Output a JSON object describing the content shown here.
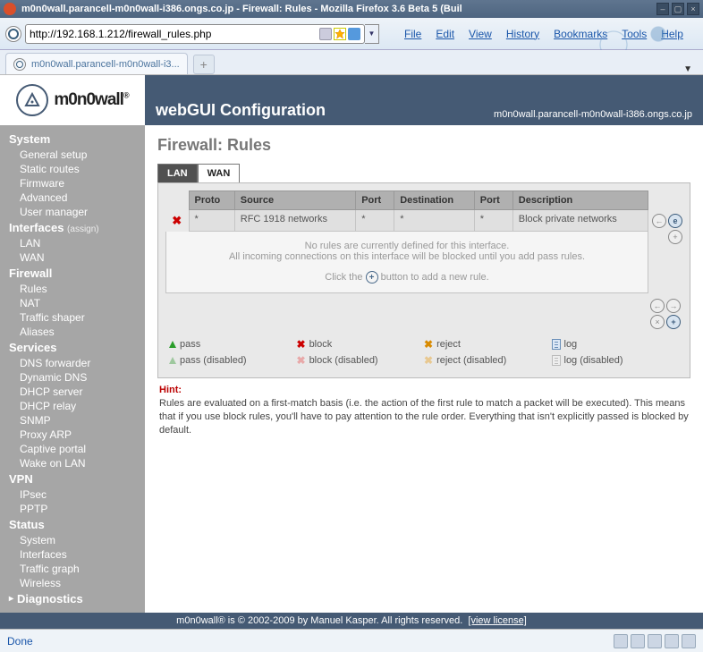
{
  "browser": {
    "window_title": "m0n0wall.parancell-m0n0wall-i386.ongs.co.jp - Firewall: Rules - Mozilla Firefox 3.6 Beta 5 (Buil",
    "url": "http://192.168.1.212/firewall_rules.php",
    "tab_title": "m0n0wall.parancell-m0n0wall-i3...",
    "menu": {
      "file": "File",
      "edit": "Edit",
      "view": "View",
      "history": "History",
      "bookmarks": "Bookmarks",
      "tools": "Tools",
      "help": "Help"
    },
    "status_text": "Done"
  },
  "logo_text": "m0n0wall",
  "header": {
    "title": "webGUI Configuration",
    "host": "m0n0wall.parancell-m0n0wall-i386.ongs.co.jp"
  },
  "sidebar": {
    "system": {
      "label": "System",
      "items": [
        "General setup",
        "Static routes",
        "Firmware",
        "Advanced",
        "User manager"
      ]
    },
    "interfaces": {
      "label": "Interfaces",
      "assign": "(assign)",
      "items": [
        "LAN",
        "WAN"
      ]
    },
    "firewall": {
      "label": "Firewall",
      "items": [
        "Rules",
        "NAT",
        "Traffic shaper",
        "Aliases"
      ]
    },
    "services": {
      "label": "Services",
      "items": [
        "DNS forwarder",
        "Dynamic DNS",
        "DHCP server",
        "DHCP relay",
        "SNMP",
        "Proxy ARP",
        "Captive portal",
        "Wake on LAN"
      ]
    },
    "vpn": {
      "label": "VPN",
      "items": [
        "IPsec",
        "PPTP"
      ]
    },
    "status": {
      "label": "Status",
      "items": [
        "System",
        "Interfaces",
        "Traffic graph",
        "Wireless"
      ]
    },
    "diagnostics": {
      "label": "Diagnostics"
    }
  },
  "page_title": "Firewall: Rules",
  "tabs": {
    "lan": "LAN",
    "wan": "WAN"
  },
  "table": {
    "headers": {
      "proto": "Proto",
      "source": "Source",
      "port": "Port",
      "dest": "Destination",
      "port2": "Port",
      "desc": "Description"
    },
    "row": {
      "proto": "*",
      "source": "RFC 1918 networks",
      "port": "*",
      "dest": "*",
      "port2": "*",
      "desc": "Block private networks"
    }
  },
  "empty": {
    "line1": "No rules are currently defined for this interface.",
    "line2": "All incoming connections on this interface will be blocked until you add pass rules.",
    "line3a": "Click the",
    "line3b": "button to add a new rule."
  },
  "legend": {
    "pass": "pass",
    "block": "block",
    "reject": "reject",
    "log": "log",
    "passd": "pass (disabled)",
    "blockd": "block (disabled)",
    "rejectd": "reject (disabled)",
    "logd": "log (disabled)"
  },
  "hint": {
    "label": "Hint:",
    "text": "Rules are evaluated on a first-match basis (i.e. the action of the first rule to match a packet will be executed). This means that if you use block rules, you'll have to pay attention to the rule order. Everything that isn't explicitly passed is blocked by default."
  },
  "footer": {
    "text": "m0n0wall® is © 2002-2009 by Manuel Kasper. All rights reserved.",
    "link": "[view license]"
  }
}
